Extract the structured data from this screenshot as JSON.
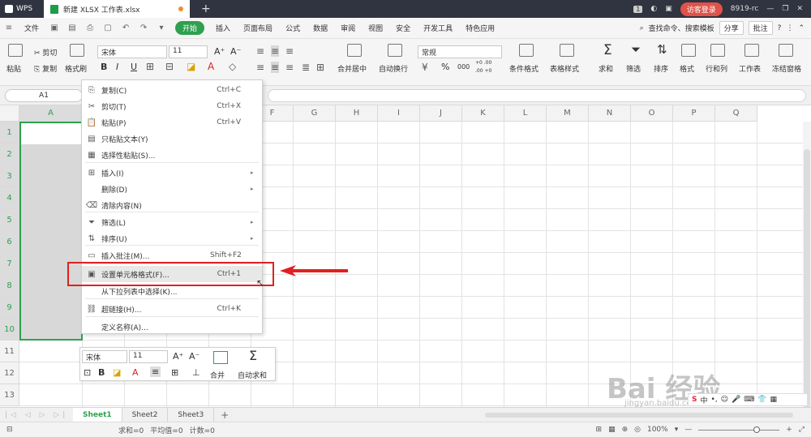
{
  "titlebar": {
    "app": "WPS",
    "doc_tab": "新建 XLSX 工作表.xlsx",
    "badge": "1",
    "login": "访客登录",
    "user": "8919-rc"
  },
  "menubar": {
    "file": "文件",
    "items": [
      "开始",
      "插入",
      "页面布局",
      "公式",
      "数据",
      "审阅",
      "视图",
      "安全",
      "开发工具",
      "特色应用"
    ],
    "search": "查找命令、搜索模板",
    "share": "分享",
    "comment": "批注"
  },
  "ribbon": {
    "paste": "粘贴",
    "cut": "剪切",
    "copy": "复制",
    "format_painter": "格式刷",
    "font_name": "宋体",
    "font_size": "11",
    "merge": "合并居中",
    "wrap": "自动换行",
    "number_format": "常规",
    "cond_format": "条件格式",
    "table_style": "表格样式",
    "sum": "求和",
    "filter": "筛选",
    "sort": "排序",
    "format": "格式",
    "rowcol": "行和列",
    "sheet": "工作表",
    "freeze": "冻结窗格",
    "bold": "B",
    "italic": "I",
    "underline": "U",
    "percent": "%",
    "thousands": "000",
    "dec_inc": "+0 .00",
    "dec_dec": ".00 +0"
  },
  "formula_bar": {
    "cell_ref": "A1"
  },
  "grid": {
    "columns": [
      "A",
      "B",
      "C",
      "D",
      "E",
      "F",
      "G",
      "H",
      "I",
      "J",
      "K",
      "L",
      "M",
      "N",
      "O",
      "P",
      "Q"
    ],
    "rows": [
      "1",
      "2",
      "3",
      "4",
      "5",
      "6",
      "7",
      "8",
      "9",
      "10",
      "11",
      "12",
      "13"
    ]
  },
  "context_menu": {
    "items": [
      {
        "icon": "copy-icon",
        "glyph": "⎘",
        "label": "复制(C)",
        "shortcut": "Ctrl+C"
      },
      {
        "icon": "scissors-icon",
        "glyph": "✂",
        "label": "剪切(T)",
        "shortcut": "Ctrl+X"
      },
      {
        "icon": "paste-icon",
        "glyph": "📋",
        "label": "粘贴(P)",
        "shortcut": "Ctrl+V"
      },
      {
        "icon": "paste-text-icon",
        "glyph": "▤",
        "label": "只粘贴文本(Y)",
        "shortcut": ""
      },
      {
        "icon": "paste-special-icon",
        "glyph": "▦",
        "label": "选择性粘贴(S)...",
        "shortcut": ""
      },
      {
        "icon": "insert-icon",
        "glyph": "⊞",
        "label": "插入(I)",
        "shortcut": ""
      },
      {
        "icon": "",
        "glyph": "",
        "label": "删除(D)",
        "shortcut": ""
      },
      {
        "icon": "clear-icon",
        "glyph": "⌫",
        "label": "清除内容(N)",
        "shortcut": ""
      },
      {
        "icon": "filter-icon",
        "glyph": "⏷",
        "label": "筛选(L)",
        "shortcut": ""
      },
      {
        "icon": "sort-icon",
        "glyph": "⇅",
        "label": "排序(U)",
        "shortcut": ""
      },
      {
        "icon": "comment-icon",
        "glyph": "▭",
        "label": "插入批注(M)...",
        "shortcut": "Shift+F2"
      },
      {
        "icon": "format-cells-icon",
        "glyph": "▣",
        "label": "设置单元格格式(F)...",
        "shortcut": "Ctrl+1"
      },
      {
        "icon": "",
        "glyph": "",
        "label": "从下拉列表中选择(K)...",
        "shortcut": ""
      },
      {
        "icon": "link-icon",
        "glyph": "⛓",
        "label": "超链接(H)...",
        "shortcut": "Ctrl+K"
      },
      {
        "icon": "",
        "glyph": "",
        "label": "定义名称(A)...",
        "shortcut": ""
      }
    ]
  },
  "mini_toolbar": {
    "font_name": "宋体",
    "font_size": "11",
    "merge": "合并",
    "autosum": "自动求和"
  },
  "sheets": {
    "tabs": [
      "Sheet1",
      "Sheet2",
      "Sheet3"
    ],
    "active": "Sheet1"
  },
  "status": {
    "sum": "求和=0",
    "avg": "平均值=0",
    "count": "计数=0",
    "zoom": "100%"
  },
  "watermark": {
    "text": "Bai 经验",
    "sub": "jingyan.baidu.com"
  },
  "ime": {
    "lang": "中"
  }
}
